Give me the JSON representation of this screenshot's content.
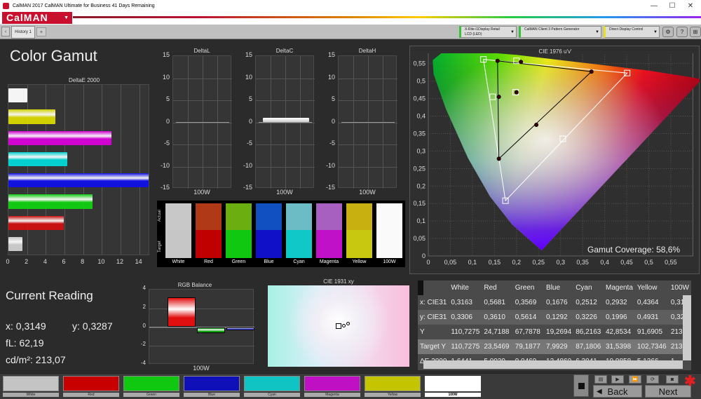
{
  "window": {
    "title": "CalMAN 2017 CalMAN Ultimate for Business 41 Days Remaining",
    "min": "—",
    "max": "☐",
    "close": "✕"
  },
  "app": {
    "logo": "CalMAN",
    "tab": "History 1",
    "tab_add": "+",
    "tab_prev": "‹"
  },
  "devices": [
    {
      "line1": "X-Rite i1Display Retail",
      "line2": "LCD (LED)",
      "color": "#38c038"
    },
    {
      "line1": "CalMAN Client 3 Pattern Generator",
      "line2": "",
      "color": "#38c038"
    },
    {
      "line1": "Direct Display Control",
      "line2": "",
      "color": "#e8e020"
    }
  ],
  "page": {
    "title": "Color Gamut"
  },
  "deltae": {
    "title": "DeltaE 2000",
    "ticks": [
      "0",
      "2",
      "4",
      "6",
      "8",
      "10",
      "12",
      "14"
    ],
    "values": [
      2.0,
      5.0,
      11.0,
      6.3,
      15.0,
      9.0,
      5.9,
      1.5
    ],
    "colors": [
      "#ffffff",
      "#d8d800",
      "#d800d8",
      "#00d8d8",
      "#1010e8",
      "#10d010",
      "#d01010",
      "#cfcfcf"
    ],
    "max": 15
  },
  "deltas": {
    "ticks": [
      "15",
      "10",
      "5",
      "0",
      "-5",
      "-10",
      "-15"
    ],
    "charts": [
      {
        "title": "DeltaL",
        "label": "100W",
        "value": 0
      },
      {
        "title": "DeltaC",
        "label": "100W",
        "value": 1
      },
      {
        "title": "DeltaH",
        "label": "100W",
        "value": 0
      }
    ]
  },
  "swatches": {
    "actual_label": "Actual",
    "target_label": "Target",
    "items": [
      {
        "name": "White",
        "actual": "#c8c8c8",
        "target": "#c6c6c6"
      },
      {
        "name": "Red",
        "actual": "#b03a18",
        "target": "#c00000"
      },
      {
        "name": "Green",
        "actual": "#6aae10",
        "target": "#10c810"
      },
      {
        "name": "Blue",
        "actual": "#1050c0",
        "target": "#1010c8"
      },
      {
        "name": "Cyan",
        "actual": "#6cbcc6",
        "target": "#10c8c8"
      },
      {
        "name": "Magenta",
        "actual": "#a860c0",
        "target": "#c010c8"
      },
      {
        "name": "Yellow",
        "actual": "#c8b010",
        "target": "#c8c810"
      },
      {
        "name": "100W",
        "actual": "#fafafa",
        "target": "#fafafa"
      }
    ]
  },
  "cie1976": {
    "title": "CIE 1976 u'v'",
    "xticks": [
      "0",
      "0,05",
      "0,1",
      "0,15",
      "0,2",
      "0,25",
      "0,3",
      "0,35",
      "0,4",
      "0,45",
      "0,5",
      "0,55"
    ],
    "yticks": [
      "0,55",
      "0,5",
      "0,45",
      "0,4",
      "0,35",
      "0,3",
      "0,25",
      "0,2",
      "0,15",
      "0,1",
      "0,05",
      "0"
    ],
    "gamut_label": "Gamut Coverage:",
    "gamut_value": "58,6%"
  },
  "current": {
    "title": "Current Reading",
    "x_label": "x:",
    "x_value": "0,3149",
    "y_label": "y:",
    "y_value": "0,3287",
    "fl_label": "fL:",
    "fl_value": "62,19",
    "cd_label": "cd/m²:",
    "cd_value": "213,07"
  },
  "rgb": {
    "title": "RGB Balance",
    "label": "100W",
    "ticks": [
      "4",
      "2",
      "0",
      "-2",
      "-4"
    ],
    "values": [
      3.2,
      -0.6,
      -0.3
    ],
    "colors": [
      "#e01010",
      "#10a010",
      "#1020e0"
    ]
  },
  "cie1931": {
    "title": "CIE 1931 xy"
  },
  "table": {
    "headers": [
      "",
      "White",
      "Red",
      "Green",
      "Blue",
      "Cyan",
      "Magenta",
      "Yellow",
      "100W"
    ],
    "rows": [
      [
        "x: CIE31",
        "0,3163",
        "0,5681",
        "0,3569",
        "0,1676",
        "0,2512",
        "0,2932",
        "0,4364",
        "0,31"
      ],
      [
        "y: CIE31",
        "0,3306",
        "0,3610",
        "0,5614",
        "0,1292",
        "0,3226",
        "0,1996",
        "0,4931",
        "0,32"
      ],
      [
        "Y",
        "110,7275",
        "24,7188",
        "67,7878",
        "19,2694",
        "86,2163",
        "42,8534",
        "91,6905",
        "213,"
      ],
      [
        "Target Y",
        "110,7275",
        "23,5469",
        "79,1877",
        "7,9929",
        "87,1806",
        "31,5398",
        "102,7346",
        "213,"
      ],
      [
        "ΔE 2000",
        "1,6441",
        "5,0039",
        "9,0469",
        "12,4860",
        "6,3041",
        "10,9858",
        "5,1366",
        "1,"
      ]
    ]
  },
  "patches": [
    {
      "name": "White",
      "color": "#c4c4c4"
    },
    {
      "name": "Red",
      "color": "#c80000"
    },
    {
      "name": "Green",
      "color": "#10c810"
    },
    {
      "name": "Blue",
      "color": "#1010b8"
    },
    {
      "name": "Cyan",
      "color": "#10c4c4"
    },
    {
      "name": "Magenta",
      "color": "#c010c4"
    },
    {
      "name": "Yellow",
      "color": "#c4c400"
    },
    {
      "name": "100W",
      "color": "#ffffff"
    }
  ],
  "nav": {
    "back": "Back",
    "next": "Next"
  }
}
